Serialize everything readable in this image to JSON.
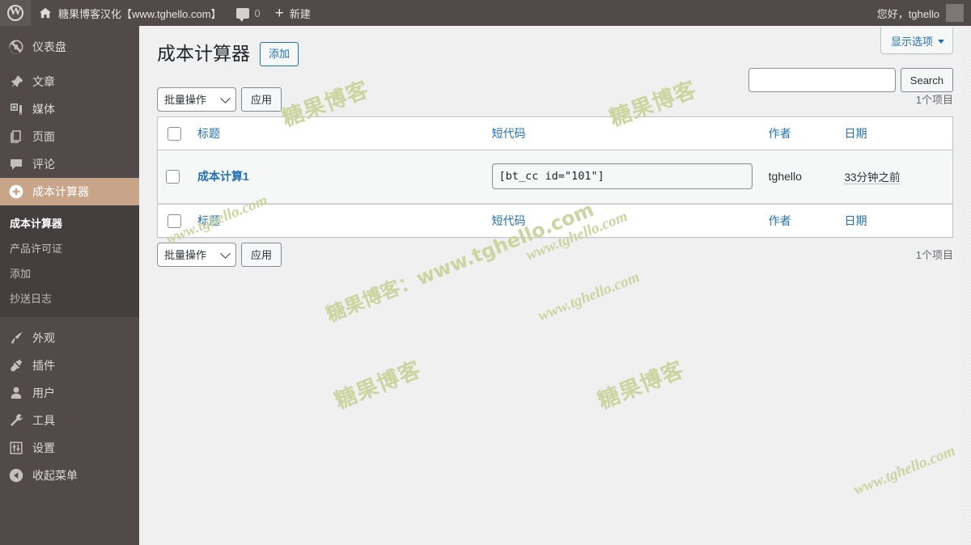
{
  "adminbar": {
    "wp_logo_icon": "wordpress-logo-icon",
    "home_icon": "home-icon",
    "site_name": "糖果博客汉化【www.tghello.com】",
    "comment_icon": "comment-bubble-icon",
    "comment_count": "0",
    "new_plus_icon": "plus-icon",
    "new_label": "新建",
    "howdy": "您好，tghello",
    "avatar": "avatar"
  },
  "sidebar": {
    "items": [
      {
        "label": "仪表盘",
        "icon": "dashboard-icon",
        "current": false
      },
      {
        "label": "文章",
        "icon": "pin-icon",
        "current": false
      },
      {
        "label": "媒体",
        "icon": "media-icon",
        "current": false
      },
      {
        "label": "页面",
        "icon": "page-icon",
        "current": false
      },
      {
        "label": "评论",
        "icon": "comment-icon",
        "current": false
      },
      {
        "label": "成本计算器",
        "icon": "plus-circle-icon",
        "current": true
      },
      {
        "label": "外观",
        "icon": "appearance-brush-icon",
        "current": false
      },
      {
        "label": "插件",
        "icon": "plugin-plug-icon",
        "current": false
      },
      {
        "label": "用户",
        "icon": "user-icon",
        "current": false
      },
      {
        "label": "工具",
        "icon": "tools-wrench-icon",
        "current": false
      },
      {
        "label": "设置",
        "icon": "settings-sliders-icon",
        "current": false
      },
      {
        "label": "收起菜单",
        "icon": "collapse-arrow-icon",
        "current": false
      }
    ],
    "submenu": [
      {
        "label": "成本计算器",
        "current": true
      },
      {
        "label": "产品许可证",
        "current": false
      },
      {
        "label": "添加",
        "current": false
      },
      {
        "label": "抄送日志",
        "current": false
      }
    ]
  },
  "screen_meta": {
    "show_settings_label": "显示选项",
    "caret_icon": "chevron-down-icon"
  },
  "page": {
    "title": "成本计算器",
    "add_new_label": "添加"
  },
  "search": {
    "value": "",
    "placeholder": "",
    "button_label": "Search"
  },
  "tablenav": {
    "bulk_action_selected": "批量操作",
    "bulk_caret_icon": "chevron-down-icon",
    "apply_label": "应用",
    "displaying_num": "1个项目"
  },
  "table": {
    "columns": [
      {
        "key": "cb",
        "label": ""
      },
      {
        "key": "title",
        "label": "标题"
      },
      {
        "key": "shortcode",
        "label": "短代码"
      },
      {
        "key": "author",
        "label": "作者"
      },
      {
        "key": "date",
        "label": "日期"
      }
    ],
    "rows": [
      {
        "title": "成本计算1",
        "shortcode": "[bt_cc id=\"101\"]",
        "author": "tghello",
        "date": "33分钟之前"
      }
    ]
  },
  "watermarks": {
    "color": "#ccd49f",
    "texts": [
      "糖果博客",
      "www.tghello.com",
      "糖果博客：www.tghello.com"
    ]
  },
  "theme": {
    "admin_bar_bg": "#51494a",
    "sidebar_bg": "#51494a",
    "submenu_bg": "#453e3f",
    "current_menu_bg": "#c8a489",
    "link_blue": "#2271b1",
    "body_bg": "#f0f0f1"
  }
}
